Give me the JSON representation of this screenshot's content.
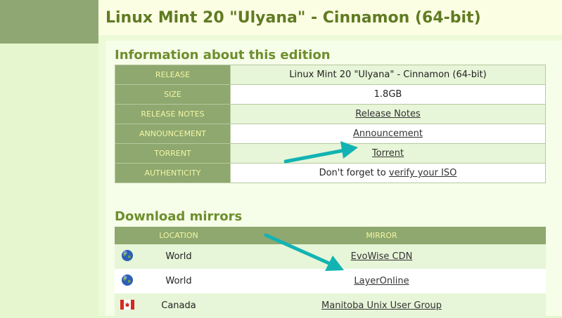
{
  "page": {
    "title": "Linux Mint 20 \"Ulyana\" - Cinnamon (64-bit)"
  },
  "info": {
    "section_title": "Information about this edition",
    "rows": [
      {
        "key": "RELEASE",
        "value": "Linux Mint 20 \"Ulyana\" - Cinnamon (64-bit)"
      },
      {
        "key": "SIZE",
        "value": "1.8GB"
      },
      {
        "key": "RELEASE NOTES",
        "value": "Release Notes"
      },
      {
        "key": "ANNOUNCEMENT",
        "value": "Announcement"
      },
      {
        "key": "TORRENT",
        "value": "Torrent"
      },
      {
        "key": "AUTHENTICITY",
        "value_prefix": "Don't forget to ",
        "value_link": "verify your ISO"
      }
    ]
  },
  "mirrors": {
    "section_title": "Download mirrors",
    "headers": {
      "location": "LOCATION",
      "mirror": "MIRROR"
    },
    "rows": [
      {
        "icon": "globe-icon",
        "location": "World",
        "mirror": "EvoWise CDN"
      },
      {
        "icon": "globe-icon",
        "location": "World",
        "mirror": "LayerOnline"
      },
      {
        "icon": "canada-flag-icon",
        "location": "Canada",
        "mirror": "Manitoba Unix User Group"
      }
    ]
  },
  "colors": {
    "header_cell": "#8ea86f",
    "header_text": "#f3f6a3",
    "title": "#607b22",
    "arrow": "#13b3b3"
  }
}
